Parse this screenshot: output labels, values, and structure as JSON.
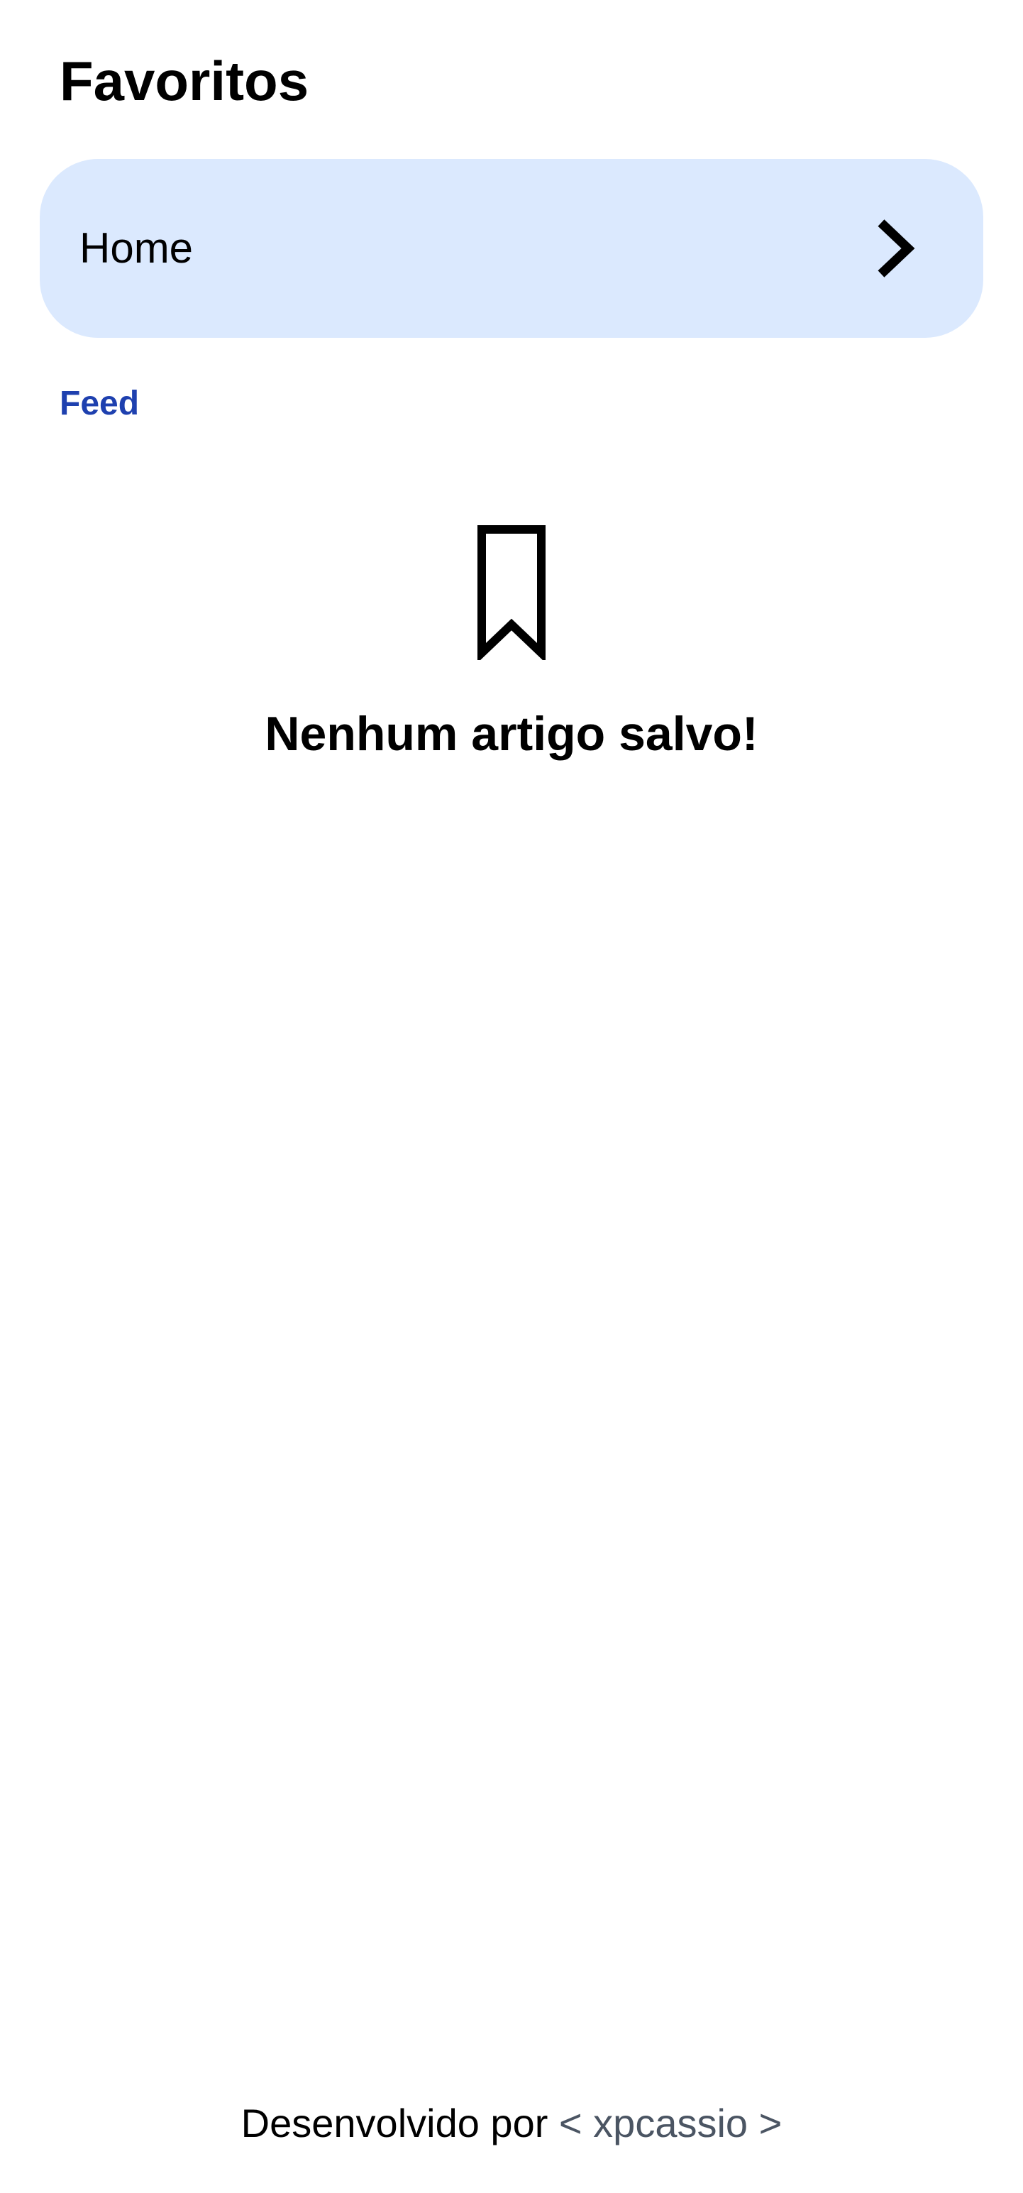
{
  "page": {
    "title": "Favoritos"
  },
  "nav_card": {
    "label": "Home",
    "icon": "chevron-right-icon"
  },
  "feed_link": {
    "label": "Feed",
    "color": "#1e40af"
  },
  "empty_state": {
    "icon": "bookmark-icon",
    "message": "Nenhum artigo salvo!"
  },
  "footer": {
    "prefix": "Desenvolvido por ",
    "credit": "< xpcassio >",
    "credit_color": "#4b5563"
  },
  "colors": {
    "card_background": "#dbe9fe",
    "text": "#000000"
  }
}
